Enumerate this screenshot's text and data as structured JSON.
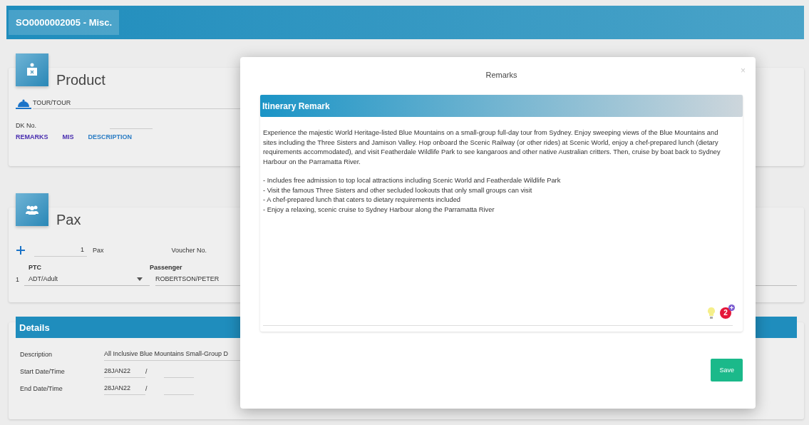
{
  "header": {
    "title": "SO0000002005 - Misc."
  },
  "product": {
    "title": "Product",
    "type_value": "TOUR/TOUR",
    "dk_label": "DK No.",
    "links": [
      {
        "label": "REMARKS",
        "selected": false
      },
      {
        "label": "MIS",
        "selected": false
      },
      {
        "label": "DESCRIPTION",
        "selected": true
      }
    ]
  },
  "pax": {
    "title": "Pax",
    "count": "1",
    "count_label": "Pax",
    "voucher_label": "Voucher No.",
    "columns": [
      "PTC",
      "Passenger"
    ],
    "rows": [
      {
        "index": "1",
        "ptc": "ADT/Adult",
        "passenger": "ROBERTSON/PETER"
      }
    ]
  },
  "details": {
    "title": "Details",
    "fields": [
      {
        "label": "Description",
        "value": "All Inclusive Blue Mountains Small-Group D",
        "kind": "text"
      },
      {
        "label": "Start Date/Time",
        "value": "28JAN22",
        "separator": "/",
        "kind": "datetime"
      },
      {
        "label": "End Date/Time",
        "value": "28JAN22",
        "separator": "/",
        "kind": "datetime"
      }
    ]
  },
  "modal": {
    "title": "Remarks",
    "close": "×",
    "section_title": "Itinerary Remark",
    "paragraph": "Experience the majestic World Heritage-listed Blue Mountains on a small-group full-day tour from Sydney. Enjoy sweeping views of the Blue Mountains and sites including the Three Sisters and Jamison Valley. Hop onboard the Scenic Railway (or other rides) at Scenic World, enjoy a chef-prepared lunch (dietary requirements accommodated), and visit Featherdale Wildlife Park to see kangaroos and other native Australian critters. Then, cruise by boat back to Sydney Harbour on the Parramatta River.",
    "bullets": [
      "- Includes free admission to top local attractions including Scenic World and Featherdale Wildlife Park",
      "- Visit the famous Three Sisters and other secluded lookouts that only small groups can visit",
      "- A chef-prepared lunch that caters to dietary requirements included",
      "- Enjoy a relaxing, scenic cruise to Sydney Harbour along the Parramatta River"
    ],
    "badge": "2",
    "save": "Save"
  }
}
